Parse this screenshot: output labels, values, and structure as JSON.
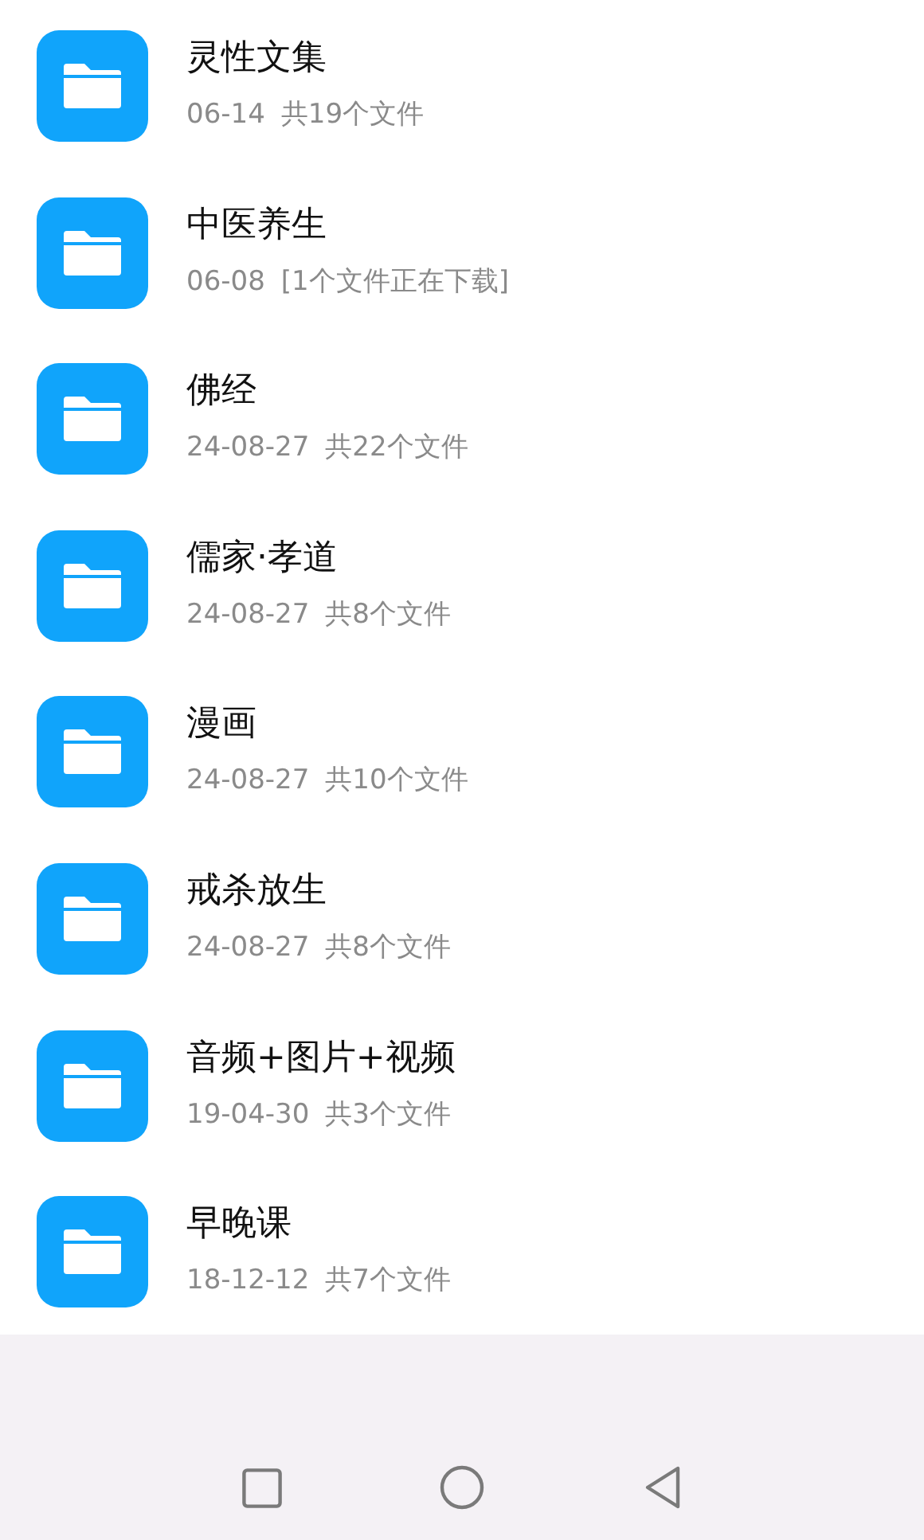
{
  "folders": [
    {
      "name": "灵性文集",
      "date": "06-14",
      "info": "共19个文件"
    },
    {
      "name": "中医养生",
      "date": "06-08",
      "info": "[1个文件正在下载]"
    },
    {
      "name": "佛经",
      "date": "24-08-27",
      "info": "共22个文件"
    },
    {
      "name": "儒家·孝道",
      "date": "24-08-27",
      "info": "共8个文件"
    },
    {
      "name": "漫画",
      "date": "24-08-27",
      "info": "共10个文件"
    },
    {
      "name": "戒杀放生",
      "date": "24-08-27",
      "info": "共8个文件"
    },
    {
      "name": "音频+图片+视频",
      "date": "19-04-30",
      "info": "共3个文件"
    },
    {
      "name": "早晚课",
      "date": "18-12-12",
      "info": "共7个文件"
    }
  ]
}
